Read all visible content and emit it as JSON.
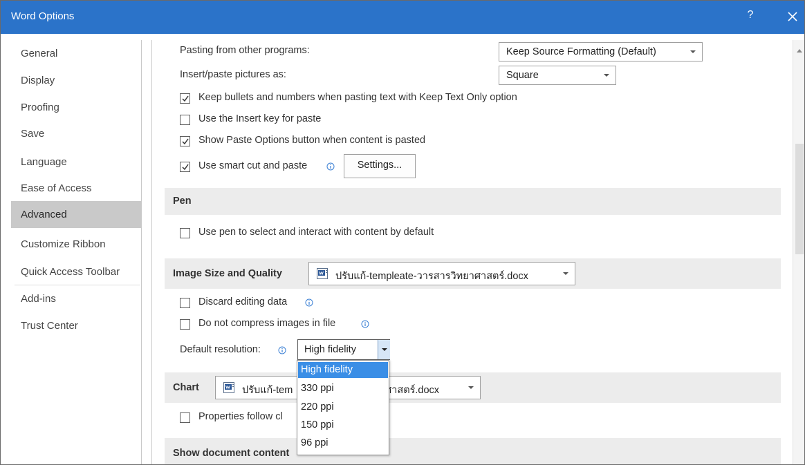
{
  "window": {
    "title": "Word Options",
    "help_label": "?"
  },
  "sidebar": {
    "items": [
      {
        "label": "General"
      },
      {
        "label": "Display"
      },
      {
        "label": "Proofing"
      },
      {
        "label": "Save"
      },
      {
        "label": "Language"
      },
      {
        "label": "Ease of Access"
      },
      {
        "label": "Advanced",
        "selected": true
      },
      {
        "label": "Customize Ribbon"
      },
      {
        "label": "Quick Access Toolbar"
      },
      {
        "label": "Add-ins"
      },
      {
        "label": "Trust Center"
      }
    ]
  },
  "paste": {
    "from_other_programs_label": "Pasting from other programs:",
    "from_other_programs_value": "Keep Source Formatting (Default)",
    "insert_pictures_label": "Insert/paste pictures as:",
    "insert_pictures_value": "Square",
    "keep_bullets_label": "Keep bullets and numbers when pasting text with Keep Text Only option",
    "keep_bullets_checked": true,
    "use_insert_key_label": "Use the Insert key for paste",
    "use_insert_key_checked": false,
    "show_paste_options_label": "Show Paste Options button when content is pasted",
    "show_paste_options_checked": true,
    "smart_cut_label": "Use smart cut and paste",
    "smart_cut_checked": true,
    "settings_button": "Settings..."
  },
  "pen": {
    "section_title": "Pen",
    "use_pen_label": "Use pen to select and interact with content by default",
    "use_pen_checked": false
  },
  "image": {
    "section_title": "Image Size and Quality",
    "document": "ปรับแก้-templeate-วารสารวิทยาศาสตร์.docx",
    "discard_label": "Discard editing data",
    "discard_checked": false,
    "no_compress_label": "Do not compress images in file",
    "no_compress_checked": false,
    "resolution_label": "Default resolution:",
    "resolution_value": "High fidelity",
    "resolution_options": [
      "High fidelity",
      "330 ppi",
      "220 ppi",
      "150 ppi",
      "96 ppi"
    ],
    "resolution_highlighted": "High fidelity"
  },
  "chart": {
    "section_title": "Chart",
    "document_visible_prefix": "ปรับแก้-tem",
    "document_visible_suffix": "ศาสตร์.docx",
    "properties_visible_label": "Properties follow cl",
    "properties_checked": false
  },
  "show_content": {
    "section_title": "Show document content"
  },
  "colors": {
    "titlebar": "#2b73c9",
    "selected_sidebar": "#c9c9c9",
    "section_bg": "#ececec",
    "highlight": "#3a8ee6",
    "info_icon": "#3a7fd4"
  },
  "icons": {
    "close": "close-icon",
    "help": "help-icon",
    "dropdown": "chevron-down-icon",
    "info": "info-icon",
    "document": "word-document-icon",
    "check": "checkmark-icon"
  }
}
